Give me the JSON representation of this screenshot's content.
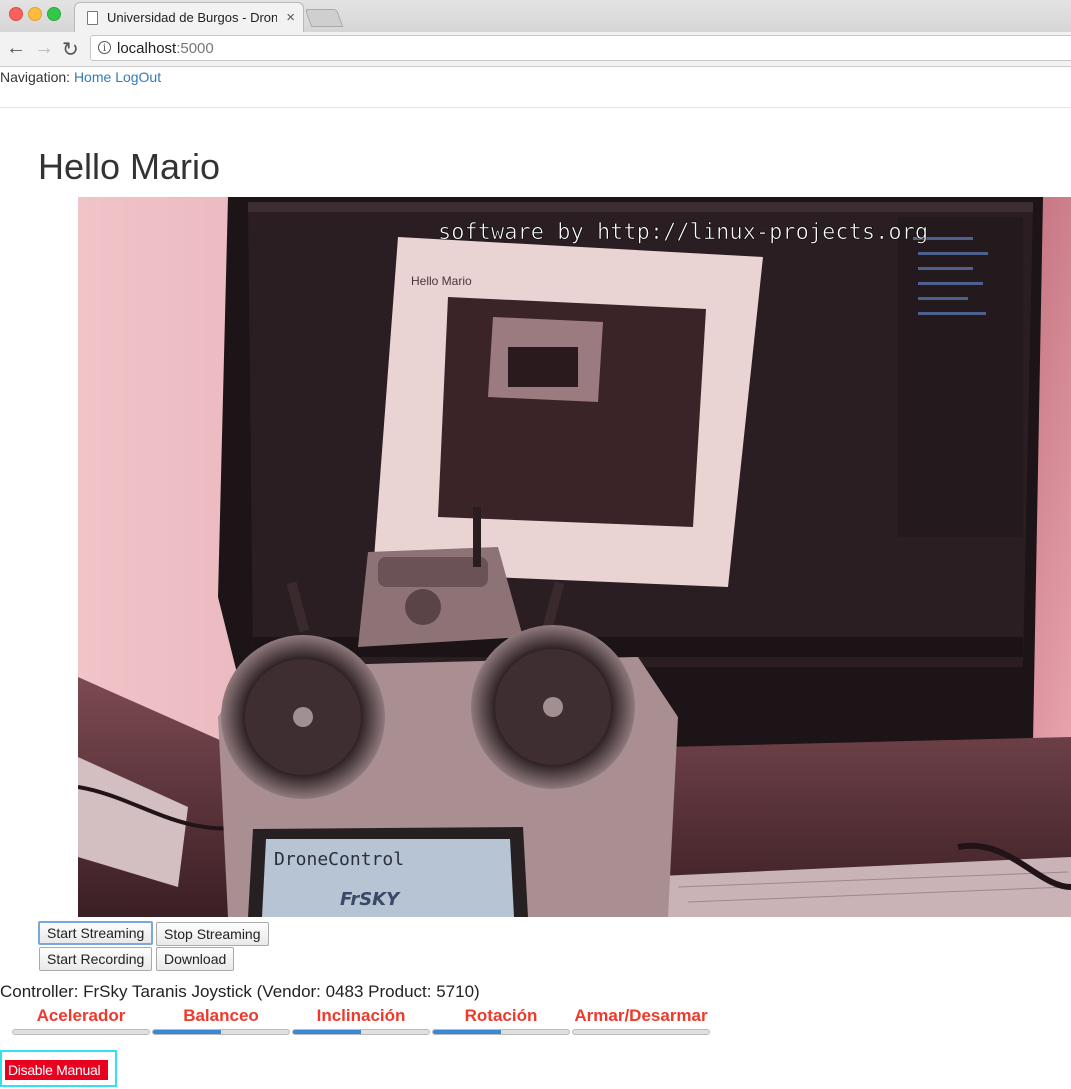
{
  "browser": {
    "tab_title": "Universidad de Burgos - Drone",
    "tab_close": "×",
    "url_host": "localhost",
    "url_port": ":5000",
    "info_glyph": "i",
    "back_glyph": "←",
    "forward_glyph": "→",
    "reload_glyph": "↻"
  },
  "nav": {
    "prefix": "Navigation:",
    "links": [
      "Home",
      "LogOut"
    ]
  },
  "heading": "Hello Mario",
  "video": {
    "overlay_text": "software by http://linux-projects.org",
    "inner_heading": "Hello Mario",
    "screen_text": "DroneControl",
    "brand_text": "FrSKY"
  },
  "buttons": {
    "start_streaming": "Start Streaming",
    "stop_streaming": "Stop Streaming",
    "start_recording": "Start Recording",
    "download": "Download"
  },
  "controller": "Controller: FrSky Taranis Joystick (Vendor: 0483 Product: 5710)",
  "axes": [
    {
      "label": "Acelerador",
      "level": 0.0
    },
    {
      "label": "Balanceo",
      "level": 0.5
    },
    {
      "label": "Inclinación",
      "level": 0.5
    },
    {
      "label": "Rotación",
      "level": 0.5
    },
    {
      "label": "Armar/Desarmar",
      "level": 0.0
    }
  ],
  "disable_button": "Disable Manual",
  "colors": {
    "link": "#337ab7",
    "axis_label": "#f0392b",
    "bar_fill": "#3b87d6",
    "disable_bg": "#e8001e",
    "disable_outline": "#33e0ee"
  }
}
